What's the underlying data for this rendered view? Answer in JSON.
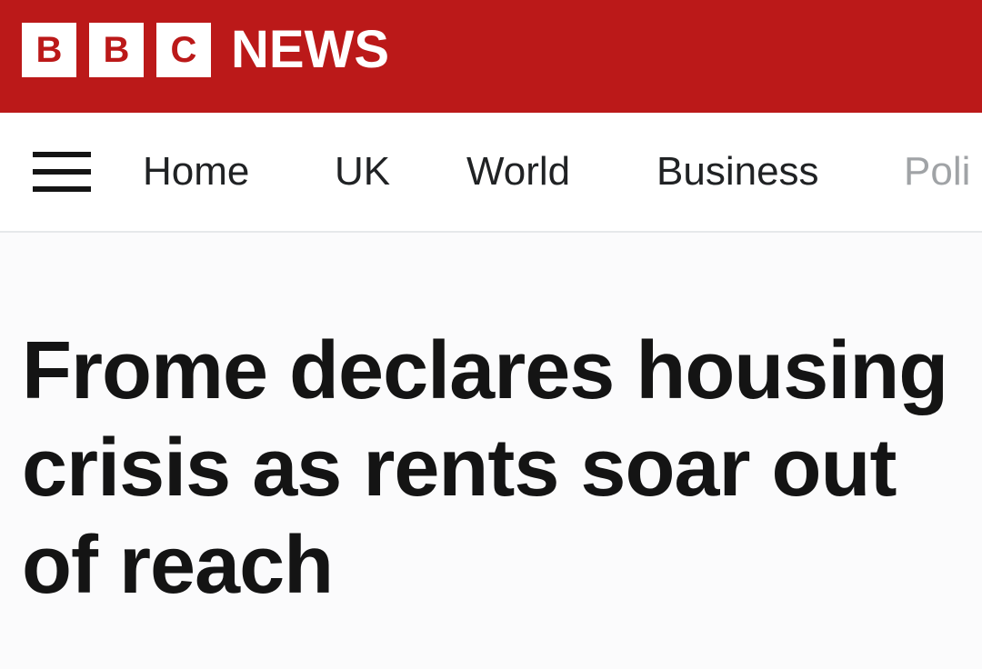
{
  "masthead": {
    "logo_letters": [
      "B",
      "B",
      "C"
    ],
    "news_label": "NEWS",
    "brand_color": "#bb1919"
  },
  "nav": {
    "menu_icon": "hamburger-menu-icon",
    "items": [
      {
        "label": "Home"
      },
      {
        "label": "UK"
      },
      {
        "label": "World"
      },
      {
        "label": "Business"
      },
      {
        "label": "Poli"
      }
    ]
  },
  "article": {
    "headline": "Frome declares housing crisis as rents soar out of reach"
  }
}
